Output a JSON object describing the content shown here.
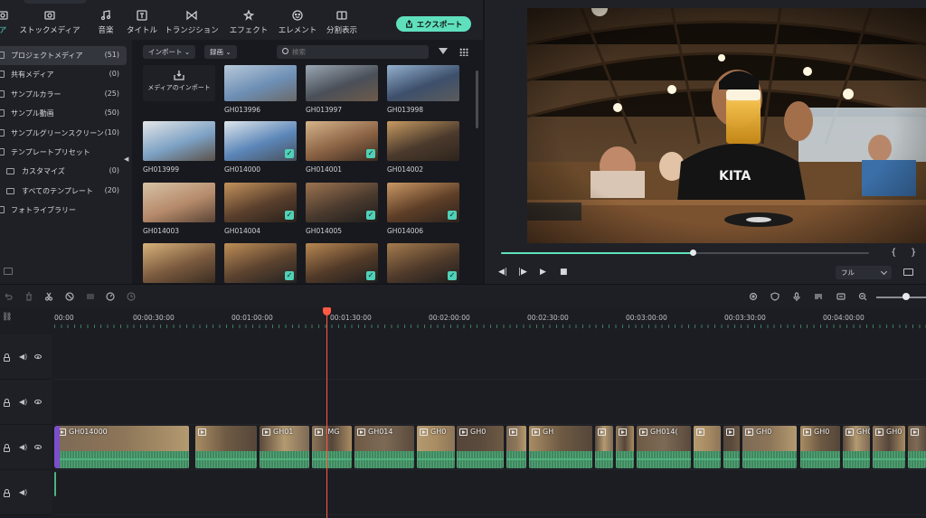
{
  "toolbar": {
    "tabs": [
      {
        "label": "ア",
        "icon": "media-icon"
      },
      {
        "label": "ストックメディア",
        "icon": "folder-icon"
      },
      {
        "label": "音楽",
        "icon": "music-icon"
      },
      {
        "label": "タイトル",
        "icon": "title-icon"
      },
      {
        "label": "トランジション",
        "icon": "transition-icon"
      },
      {
        "label": "エフェクト",
        "icon": "effect-icon"
      },
      {
        "label": "エレメント",
        "icon": "element-icon"
      },
      {
        "label": "分割表示",
        "icon": "split-icon"
      }
    ],
    "export_label": "エクスポート"
  },
  "sidebar": {
    "items": [
      {
        "label": "プロジェクトメディア",
        "count": "(51)",
        "active": true
      },
      {
        "label": "共有メディア",
        "count": "(0)"
      },
      {
        "label": "サンプルカラー",
        "count": "(25)"
      },
      {
        "label": "サンプル動画",
        "count": "(50)"
      },
      {
        "label": "サンプルグリーンスクリーン",
        "count": "(10)"
      },
      {
        "label": "テンプレートプリセット",
        "count": ""
      },
      {
        "label": "カスタマイズ",
        "count": "(0)",
        "sub": true
      },
      {
        "label": "すべてのテンプレート",
        "count": "(20)",
        "sub": true
      },
      {
        "label": "フォトライブラリー",
        "count": ""
      }
    ]
  },
  "media": {
    "import_dropdown": "インポート",
    "record_dropdown": "録画",
    "search_placeholder": "検索",
    "import_tile_label": "メディアのインポート",
    "thumbnails": [
      {
        "name": "GH013996",
        "checked": false
      },
      {
        "name": "GH013997",
        "checked": false
      },
      {
        "name": "GH013998",
        "checked": false
      },
      {
        "name": "GH013999",
        "checked": false
      },
      {
        "name": "GH014000",
        "checked": true
      },
      {
        "name": "GH014001",
        "checked": true
      },
      {
        "name": "GH014002",
        "checked": false
      },
      {
        "name": "GH014003",
        "checked": false
      },
      {
        "name": "GH014004",
        "checked": true
      },
      {
        "name": "GH014005",
        "checked": true
      },
      {
        "name": "GH014006",
        "checked": true
      },
      {
        "name": "",
        "checked": false
      },
      {
        "name": "",
        "checked": true
      },
      {
        "name": "",
        "checked": true
      },
      {
        "name": "",
        "checked": true
      }
    ]
  },
  "preview": {
    "progress": 0.52,
    "quality": "フル",
    "mark_in": "{",
    "mark_out": "}"
  },
  "ruler": {
    "labels": [
      "00:00",
      "00:00:30:00",
      "00:01:00:00",
      "00:01:30:00",
      "00:02:00:00",
      "00:02:30:00",
      "00:03:00:00",
      "00:03:30:00",
      "00:04:00:00"
    ]
  },
  "timeline": {
    "clips": [
      "GH014000",
      "",
      "GH01",
      "IMG",
      "GH014",
      "GH0",
      "GH0",
      "",
      "GH",
      "",
      "",
      "GH014(",
      "",
      "",
      "GH0",
      "GH0",
      "GH0",
      "GH0",
      ""
    ]
  },
  "colors": {
    "accent": "#5fe0bd",
    "playhead": "#ff5a45",
    "clip_audio": "#3b8a5e"
  }
}
